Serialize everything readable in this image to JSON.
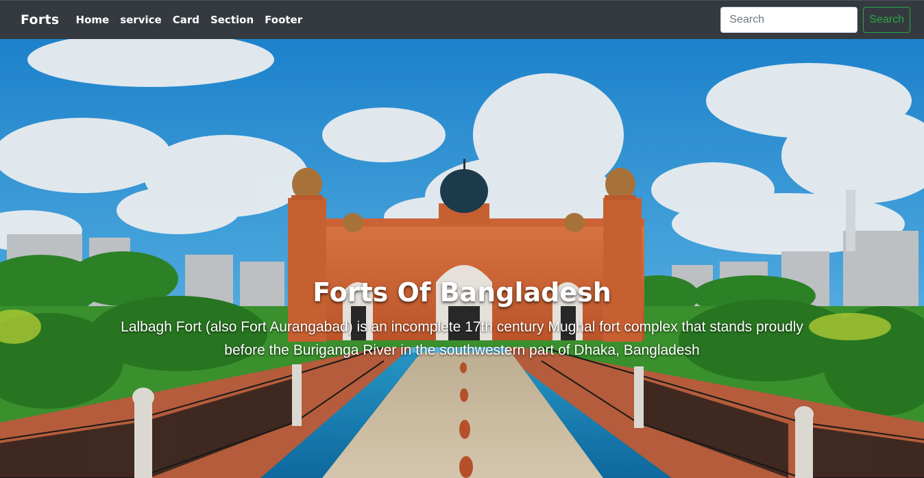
{
  "navbar": {
    "brand": "Forts",
    "links": [
      "Home",
      "service",
      "Card",
      "Section",
      "Footer"
    ],
    "search": {
      "placeholder": "Search",
      "button_label": "Search"
    },
    "colors": {
      "background": "#343a40",
      "search_button": "#28a745"
    }
  },
  "hero": {
    "title": "Forts Of Bangladesh",
    "description": "Lalbagh Fort (also Fort Aurangabad) is an incomplete 17th century Mughal fort complex that stands proudly before the Buriganga River in the southwestern part of Dhaka, Bangladesh",
    "image": "lalbagh-fort-photo"
  }
}
